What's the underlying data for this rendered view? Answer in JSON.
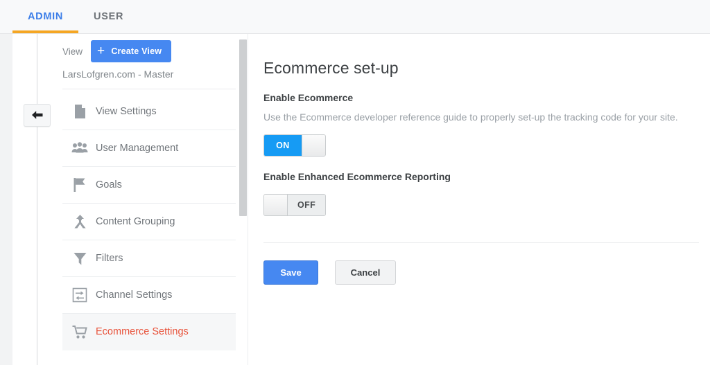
{
  "tabs": [
    {
      "label": "ADMIN",
      "active": true
    },
    {
      "label": "USER",
      "active": false
    }
  ],
  "rail": {
    "back_button_icon": "arrow-left-icon"
  },
  "sidebar": {
    "view_label": "View",
    "create_view_button": "Create View",
    "create_view_plus": "+",
    "account_name": "LarsLofgren.com - Master",
    "items": [
      {
        "label": "View Settings",
        "icon": "document-icon",
        "active": false
      },
      {
        "label": "User Management",
        "icon": "people-icon",
        "active": false
      },
      {
        "label": "Goals",
        "icon": "flag-icon",
        "active": false
      },
      {
        "label": "Content Grouping",
        "icon": "branch-arrow-icon",
        "active": false
      },
      {
        "label": "Filters",
        "icon": "funnel-icon",
        "active": false
      },
      {
        "label": "Channel Settings",
        "icon": "channel-arrows-icon",
        "active": false
      },
      {
        "label": "Ecommerce Settings",
        "icon": "shopping-cart-icon",
        "active": true
      }
    ]
  },
  "main": {
    "title": "Ecommerce set-up",
    "enable_ecommerce_label": "Enable Ecommerce",
    "enable_ecommerce_description": "Use the Ecommerce developer reference guide to properly set-up the tracking code for your site.",
    "enable_ecommerce_toggle": {
      "state": "ON",
      "on_text": "ON"
    },
    "enhanced_reporting_label": "Enable Enhanced Ecommerce Reporting",
    "enhanced_reporting_toggle": {
      "state": "OFF",
      "off_text": "OFF"
    },
    "save_button": "Save",
    "cancel_button": "Cancel"
  },
  "colors": {
    "tab_active": "#3c7ee8",
    "tab_underline": "#f5a623",
    "primary_button": "#4688f1",
    "toggle_on": "#169bf4",
    "active_nav_text": "#e8533b"
  }
}
